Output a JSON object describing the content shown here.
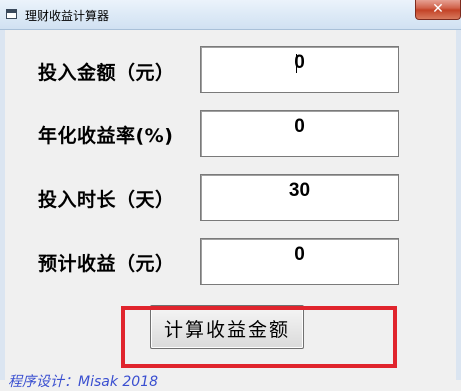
{
  "window": {
    "title": "理财收益计算器",
    "close_glyph": "✕"
  },
  "form": {
    "fields": [
      {
        "label": "投入金额（元）",
        "value": "0"
      },
      {
        "label": "年化收益率(%)",
        "value": "0"
      },
      {
        "label": "投入时长（天）",
        "value": "30"
      },
      {
        "label": "预计收益（元）",
        "value": "0"
      }
    ]
  },
  "actions": {
    "calculate_label": "计算收益金额"
  },
  "footer": {
    "text": "程序设计：Misak 2018"
  },
  "colors": {
    "highlight": "#e0242d",
    "close_button": "#c34226",
    "footer_text": "#3a4fd0"
  },
  "icons": {
    "app": "window-icon",
    "close": "close-icon"
  }
}
